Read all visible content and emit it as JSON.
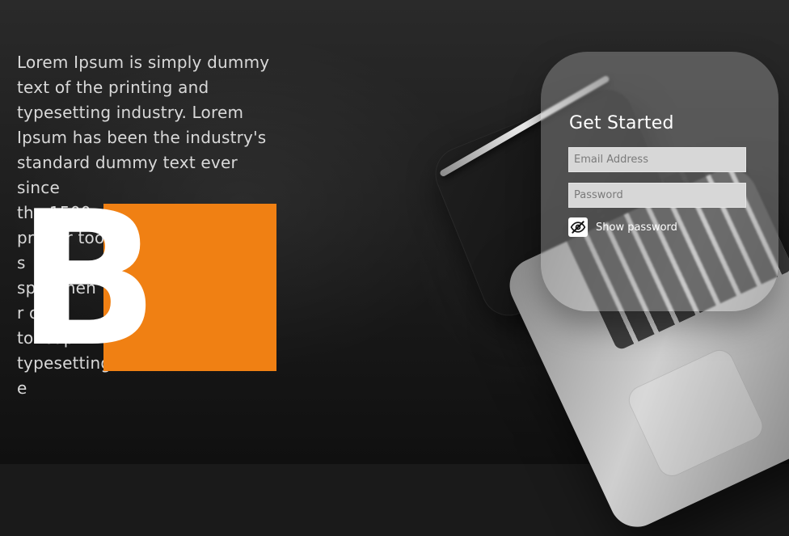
{
  "left_copy": {
    "lines": [
      "Lorem Ipsum is simply dummy",
      "text of the printing and",
      "typesetting industry. Lorem",
      "Ipsum has been the industry's",
      "standard dummy text ever since",
      "the 1500s, when an unknown",
      "printer took",
      "s",
      "specimen",
      "r only",
      "to leap",
      "typesetting",
      "e"
    ]
  },
  "logo": {
    "letter": "B",
    "accent_color": "#f08013"
  },
  "login": {
    "title": "Get Started",
    "email_placeholder": "Email Address",
    "password_placeholder": "Password",
    "show_password_label": "Show password",
    "show_password_icon": "eye-slash-icon"
  }
}
